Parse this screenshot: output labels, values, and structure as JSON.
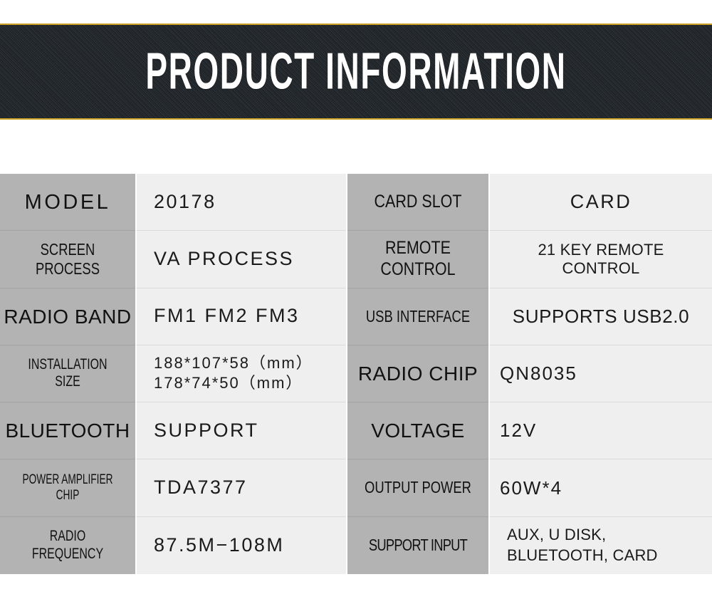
{
  "banner": {
    "title": "PRODUCT INFORMATION",
    "background_color": "#23282d",
    "border_color": "#c9a227",
    "text_color": "#ffffff"
  },
  "table": {
    "label_bg": "#b3b3b3",
    "value_bg": "#efefef",
    "rows": [
      {
        "label_left": "MODEL",
        "value_left": "20178",
        "label_right": "CARD SLOT",
        "value_right": "CARD"
      },
      {
        "label_left": "SCREEN PROCESS",
        "value_left": "VA PROCESS",
        "label_right": "REMOTE CONTROL",
        "value_right": "21 KEY REMOTE CONTROL"
      },
      {
        "label_left": "RADIO BAND",
        "value_left": "FM1 FM2 FM3",
        "label_right": "USB INTERFACE",
        "value_right": "SUPPORTS USB2.0"
      },
      {
        "label_left": "INSTALLATION SIZE",
        "value_left": "188*107*58（mm）\n178*74*50（mm）",
        "label_right": "RADIO CHIP",
        "value_right": "QN8035"
      },
      {
        "label_left": "BLUETOOTH",
        "value_left": "SUPPORT",
        "label_right": "VOLTAGE",
        "value_right": "12V"
      },
      {
        "label_left": "POWER AMPLIFIER CHIP",
        "value_left": "TDA7377",
        "label_right": "OUTPUT POWER",
        "value_right": "60W*4"
      },
      {
        "label_left": "RADIO FREQUENCY",
        "value_left": "87.5M−108M",
        "label_right": "SUPPORT INPUT",
        "value_right": "AUX, U DISK, BLUETOOTH, CARD"
      }
    ]
  }
}
